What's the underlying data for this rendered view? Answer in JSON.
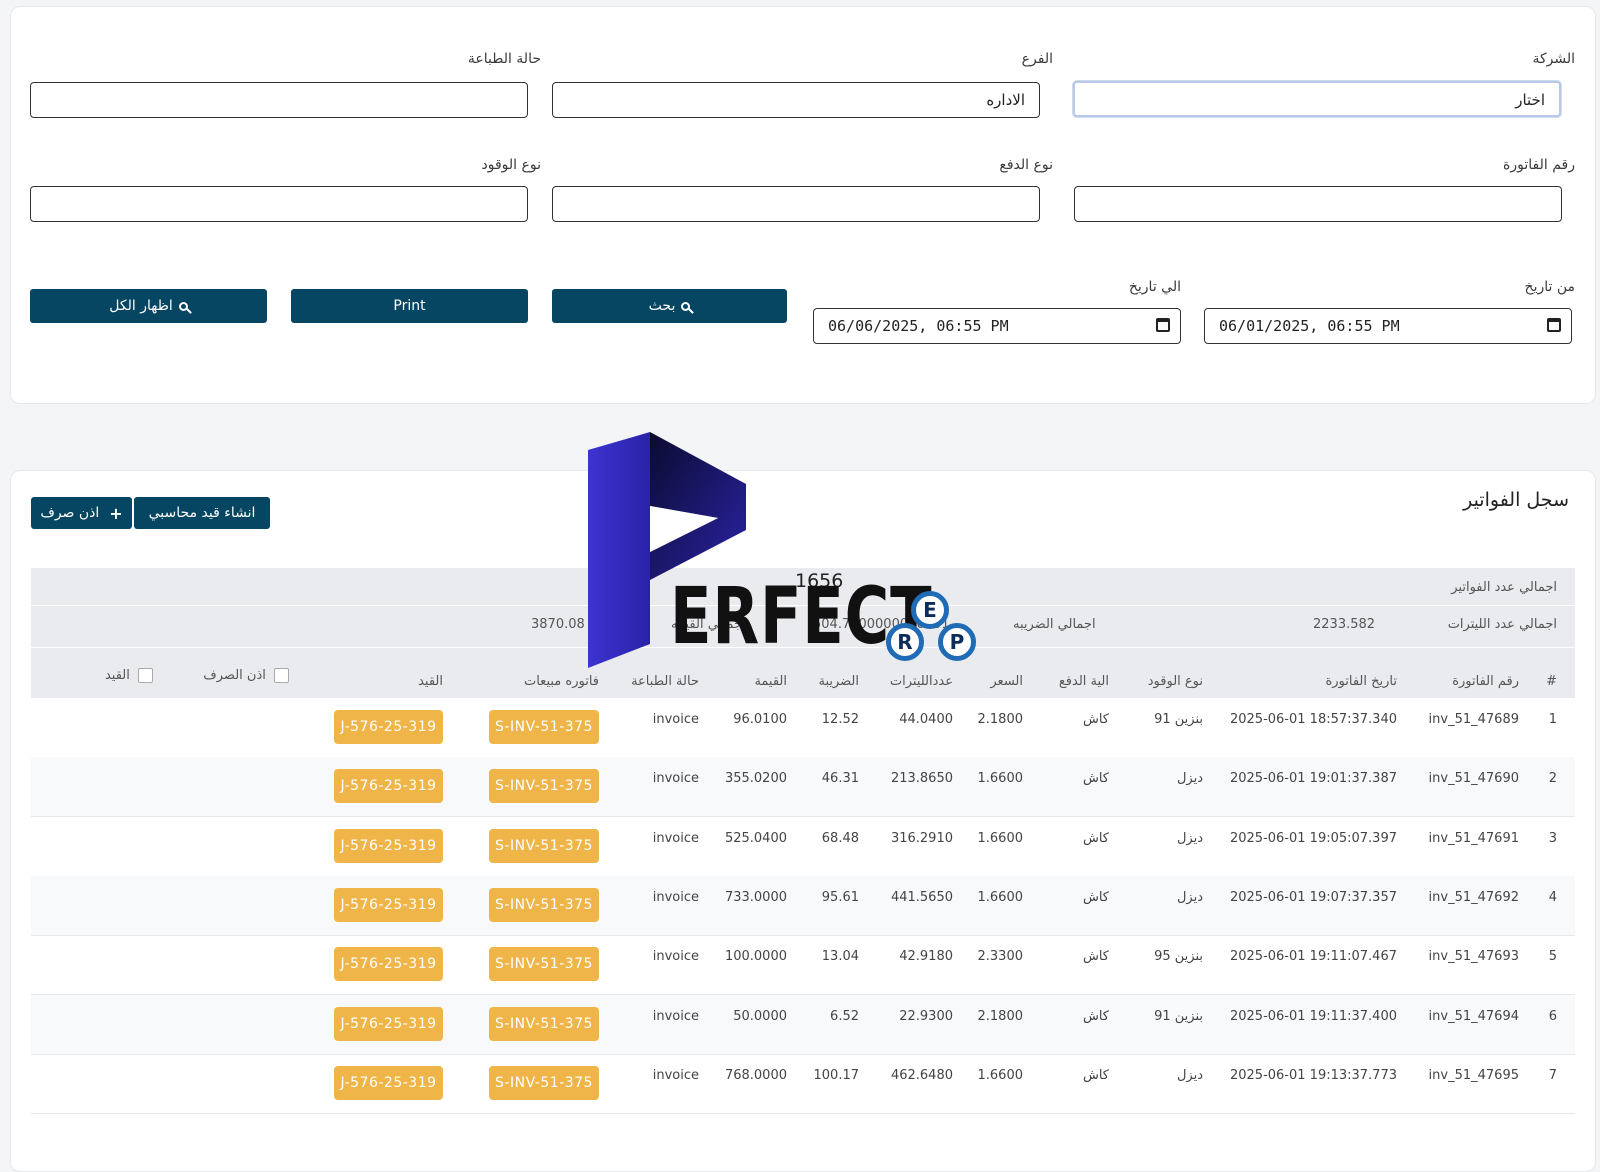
{
  "filters": {
    "company_label": "الشركة",
    "company_value": "اختار",
    "branch_label": "الفرع",
    "branch_value": "الاداره",
    "print_status_label": "حالة الطباعة",
    "print_status_value": "",
    "invoice_no_label": "رقم الفاتورة",
    "invoice_no_value": "",
    "payment_type_label": "نوع الدفع",
    "payment_type_value": "",
    "fuel_type_label": "نوع الوقود",
    "fuel_type_value": "",
    "from_date_label": "من تاريخ",
    "from_date_value": "06/01/2025, 06:55 PM",
    "to_date_label": "الي تاريخ",
    "to_date_value": "06/06/2025, 06:55 PM",
    "search_label": "بحث",
    "print_label": "Print",
    "show_all_label": "اظهار الكل"
  },
  "records": {
    "title": "سجل الفواتير",
    "create_entry_label": "انشاء قيد محاسبي",
    "disbursement_label": "اذن صرف",
    "summary": {
      "total_invoices_label": "اجمالي عدد الفواتير",
      "total_invoices_value": "1656",
      "total_liters_label": "اجمالي عدد الليترات",
      "total_liters_value": "2233.582",
      "total_tax_label": "اجمالي الضريبه",
      "total_tax_value": "504.7500000000001",
      "total_value_label": "اجمالي القيمه",
      "total_value_value": "3870.08"
    },
    "columns": {
      "num": "#",
      "invoice_no": "رقم الفاتورة",
      "invoice_date": "تاريخ الفاتورة",
      "fuel_type": "نوع الوقود",
      "payment_method": "الية الدفع",
      "price": "السعر",
      "liters": "عددالليترات",
      "tax": "الضريبة",
      "value": "القيمة",
      "print_status": "حالة الطباعة",
      "sales_invoice": "فاتوره مبيعات",
      "entry": "القيد",
      "disbursement": "اذن الصرف",
      "entry_check": "القيد"
    },
    "rows": [
      {
        "num": "1",
        "invoice_no": "inv_51_47689",
        "date": "2025-06-01 18:57:37.340",
        "fuel": "بنزين 91",
        "pay": "كاش",
        "price": "2.1800",
        "liters": "44.0400",
        "tax": "12.52",
        "value": "96.0100",
        "status": "invoice",
        "sales": "S-INV-51-375",
        "entry": "J-576-25-319"
      },
      {
        "num": "2",
        "invoice_no": "inv_51_47690",
        "date": "2025-06-01 19:01:37.387",
        "fuel": "ديزل",
        "pay": "كاش",
        "price": "1.6600",
        "liters": "213.8650",
        "tax": "46.31",
        "value": "355.0200",
        "status": "invoice",
        "sales": "S-INV-51-375",
        "entry": "J-576-25-319"
      },
      {
        "num": "3",
        "invoice_no": "inv_51_47691",
        "date": "2025-06-01 19:05:07.397",
        "fuel": "ديزل",
        "pay": "كاش",
        "price": "1.6600",
        "liters": "316.2910",
        "tax": "68.48",
        "value": "525.0400",
        "status": "invoice",
        "sales": "S-INV-51-375",
        "entry": "J-576-25-319"
      },
      {
        "num": "4",
        "invoice_no": "inv_51_47692",
        "date": "2025-06-01 19:07:37.357",
        "fuel": "ديزل",
        "pay": "كاش",
        "price": "1.6600",
        "liters": "441.5650",
        "tax": "95.61",
        "value": "733.0000",
        "status": "invoice",
        "sales": "S-INV-51-375",
        "entry": "J-576-25-319"
      },
      {
        "num": "5",
        "invoice_no": "inv_51_47693",
        "date": "2025-06-01 19:11:07.467",
        "fuel": "بنزين 95",
        "pay": "كاش",
        "price": "2.3300",
        "liters": "42.9180",
        "tax": "13.04",
        "value": "100.0000",
        "status": "invoice",
        "sales": "S-INV-51-375",
        "entry": "J-576-25-319"
      },
      {
        "num": "6",
        "invoice_no": "inv_51_47694",
        "date": "2025-06-01 19:11:37.400",
        "fuel": "بنزين 91",
        "pay": "كاش",
        "price": "2.1800",
        "liters": "22.9300",
        "tax": "6.52",
        "value": "50.0000",
        "status": "invoice",
        "sales": "S-INV-51-375",
        "entry": "J-576-25-319"
      },
      {
        "num": "7",
        "invoice_no": "inv_51_47695",
        "date": "2025-06-01 19:13:37.773",
        "fuel": "ديزل",
        "pay": "كاش",
        "price": "1.6600",
        "liters": "462.6480",
        "tax": "100.17",
        "value": "768.0000",
        "status": "invoice",
        "sales": "S-INV-51-375",
        "entry": "J-576-25-319"
      }
    ]
  },
  "watermark": {
    "text": "ERFECT",
    "letters": [
      "E",
      "R",
      "P"
    ],
    "color_primary": "#3a2fc4",
    "color_dark": "#0c0c3a",
    "color_blue": "#1f6bb5"
  },
  "colors": {
    "primary_button": "#064663",
    "tag": "#f0b548"
  }
}
